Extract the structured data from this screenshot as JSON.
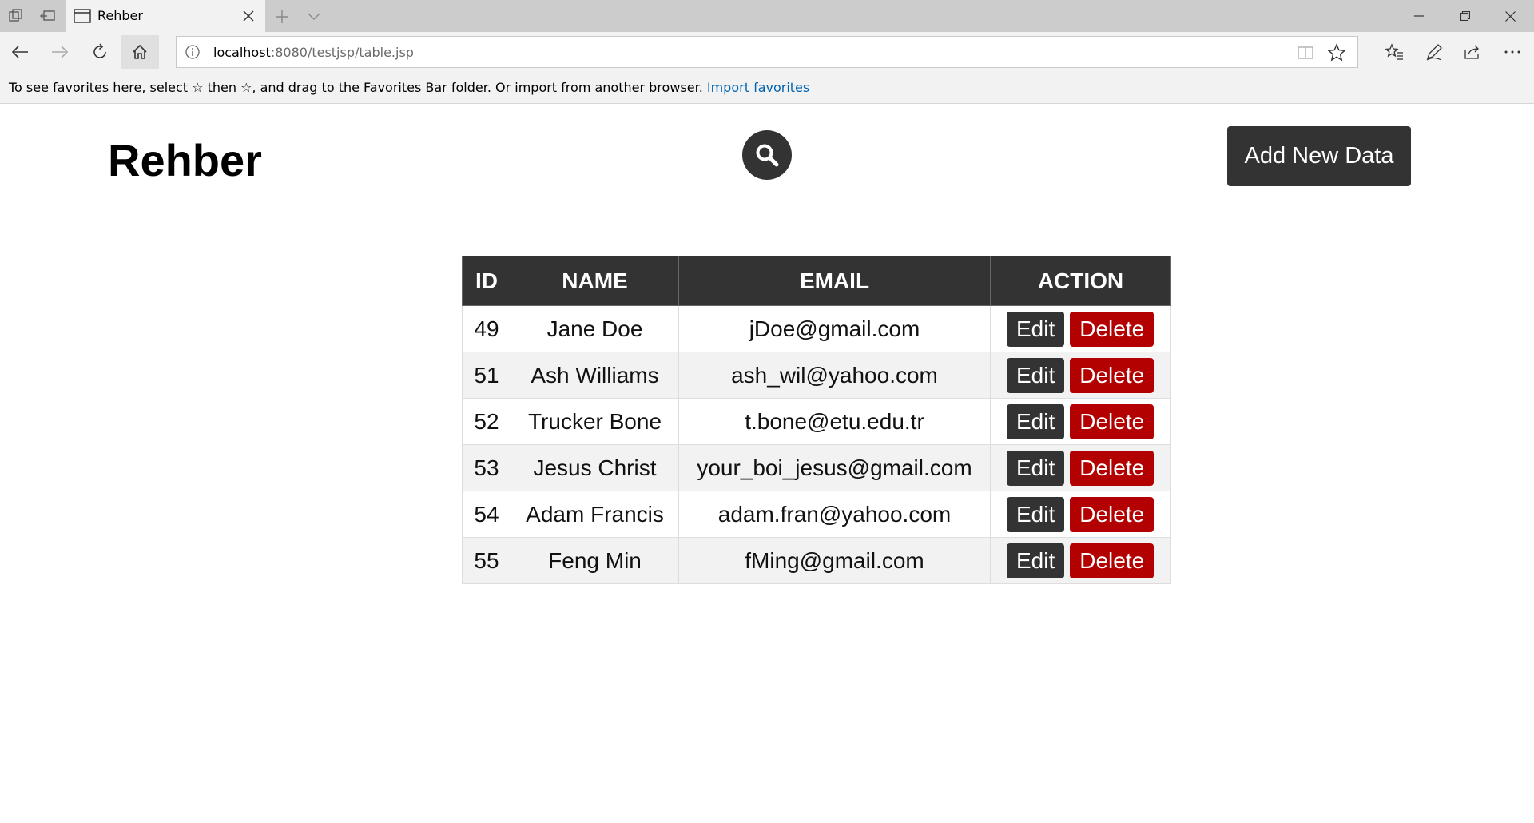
{
  "browser": {
    "tab_title": "Rehber",
    "url_host": "localhost",
    "url_rest": ":8080/testjsp/table.jsp",
    "favorites_text": "To see favorites here, select ☆ then ☆, and drag to the Favorites Bar folder. Or import from another browser.",
    "favorites_link": "Import favorites",
    "link_color": "#0063b1"
  },
  "page": {
    "title": "Rehber",
    "add_button": "Add New Data",
    "search_icon": "search-icon"
  },
  "table": {
    "headers": {
      "id": "ID",
      "name": "NAME",
      "email": "EMAIL",
      "action": "ACTION"
    },
    "edit_label": "Edit",
    "delete_label": "Delete",
    "rows": [
      {
        "id": "49",
        "name": "Jane Doe",
        "email": "jDoe@gmail.com"
      },
      {
        "id": "51",
        "name": "Ash Williams",
        "email": "ash_wil@yahoo.com"
      },
      {
        "id": "52",
        "name": "Trucker Bone",
        "email": "t.bone@etu.edu.tr"
      },
      {
        "id": "53",
        "name": "Jesus Christ",
        "email": "your_boi_jesus@gmail.com"
      },
      {
        "id": "54",
        "name": "Adam Francis",
        "email": "adam.fran@yahoo.com"
      },
      {
        "id": "55",
        "name": "Feng Min",
        "email": "fMing@gmail.com"
      }
    ]
  },
  "colors": {
    "header_bg": "#333333",
    "delete_red": "#b30000",
    "row_alt": "#f2f2f2"
  }
}
